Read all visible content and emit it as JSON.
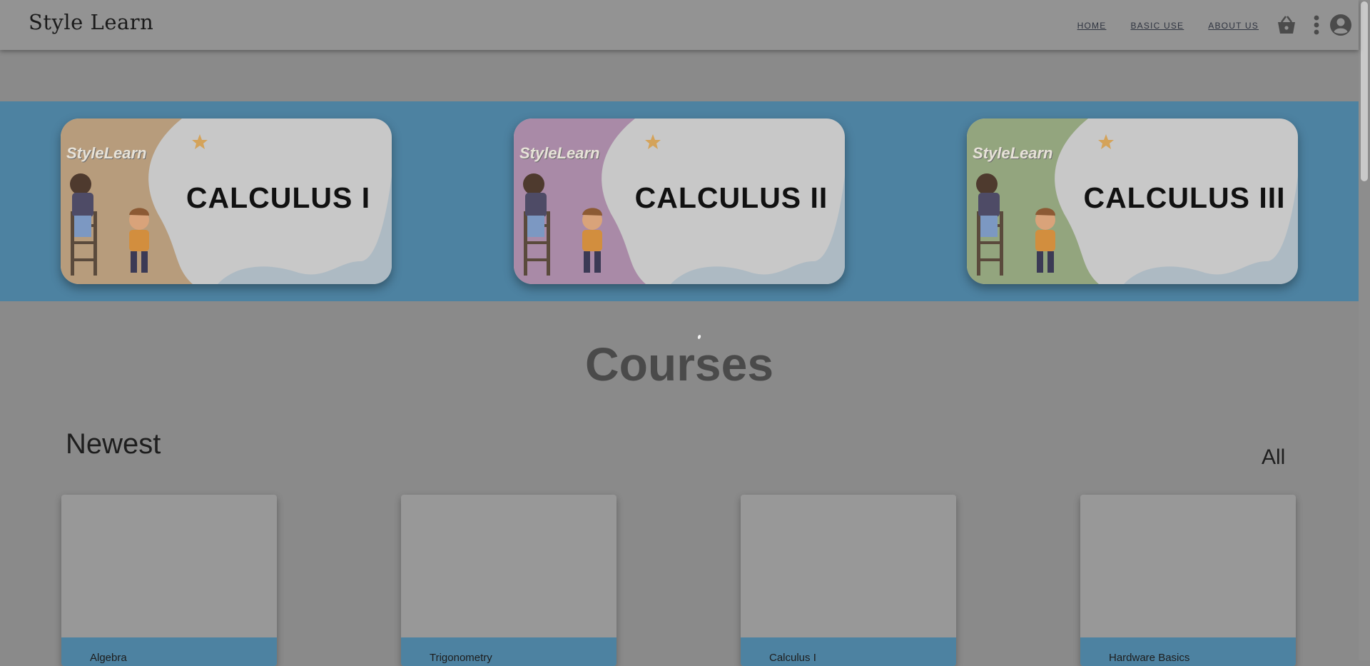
{
  "header": {
    "logo": "Style Learn",
    "nav": [
      "HOME",
      "BASIC USE",
      "ABOUT US"
    ],
    "icons": [
      "basket-icon",
      "more-vertical-icon",
      "account-icon"
    ]
  },
  "banner": {
    "cards": [
      {
        "brand": "StyleLearn",
        "title": "CALCULUS I",
        "color": "#b79c7c"
      },
      {
        "brand": "StyleLearn",
        "title": "CALCULUS II",
        "color": "#a98aa7"
      },
      {
        "brand": "StyleLearn",
        "title": "CALCULUS III",
        "color": "#93a57e"
      }
    ]
  },
  "courses": {
    "title": "Courses",
    "newest": "Newest",
    "all": "All",
    "items": [
      "Algebra",
      "Trigonometry",
      "Calculus I",
      "Hardware Basics"
    ]
  },
  "colors": {
    "accent": "#4d82a1",
    "overlay_bg": "#8a8a8a"
  }
}
